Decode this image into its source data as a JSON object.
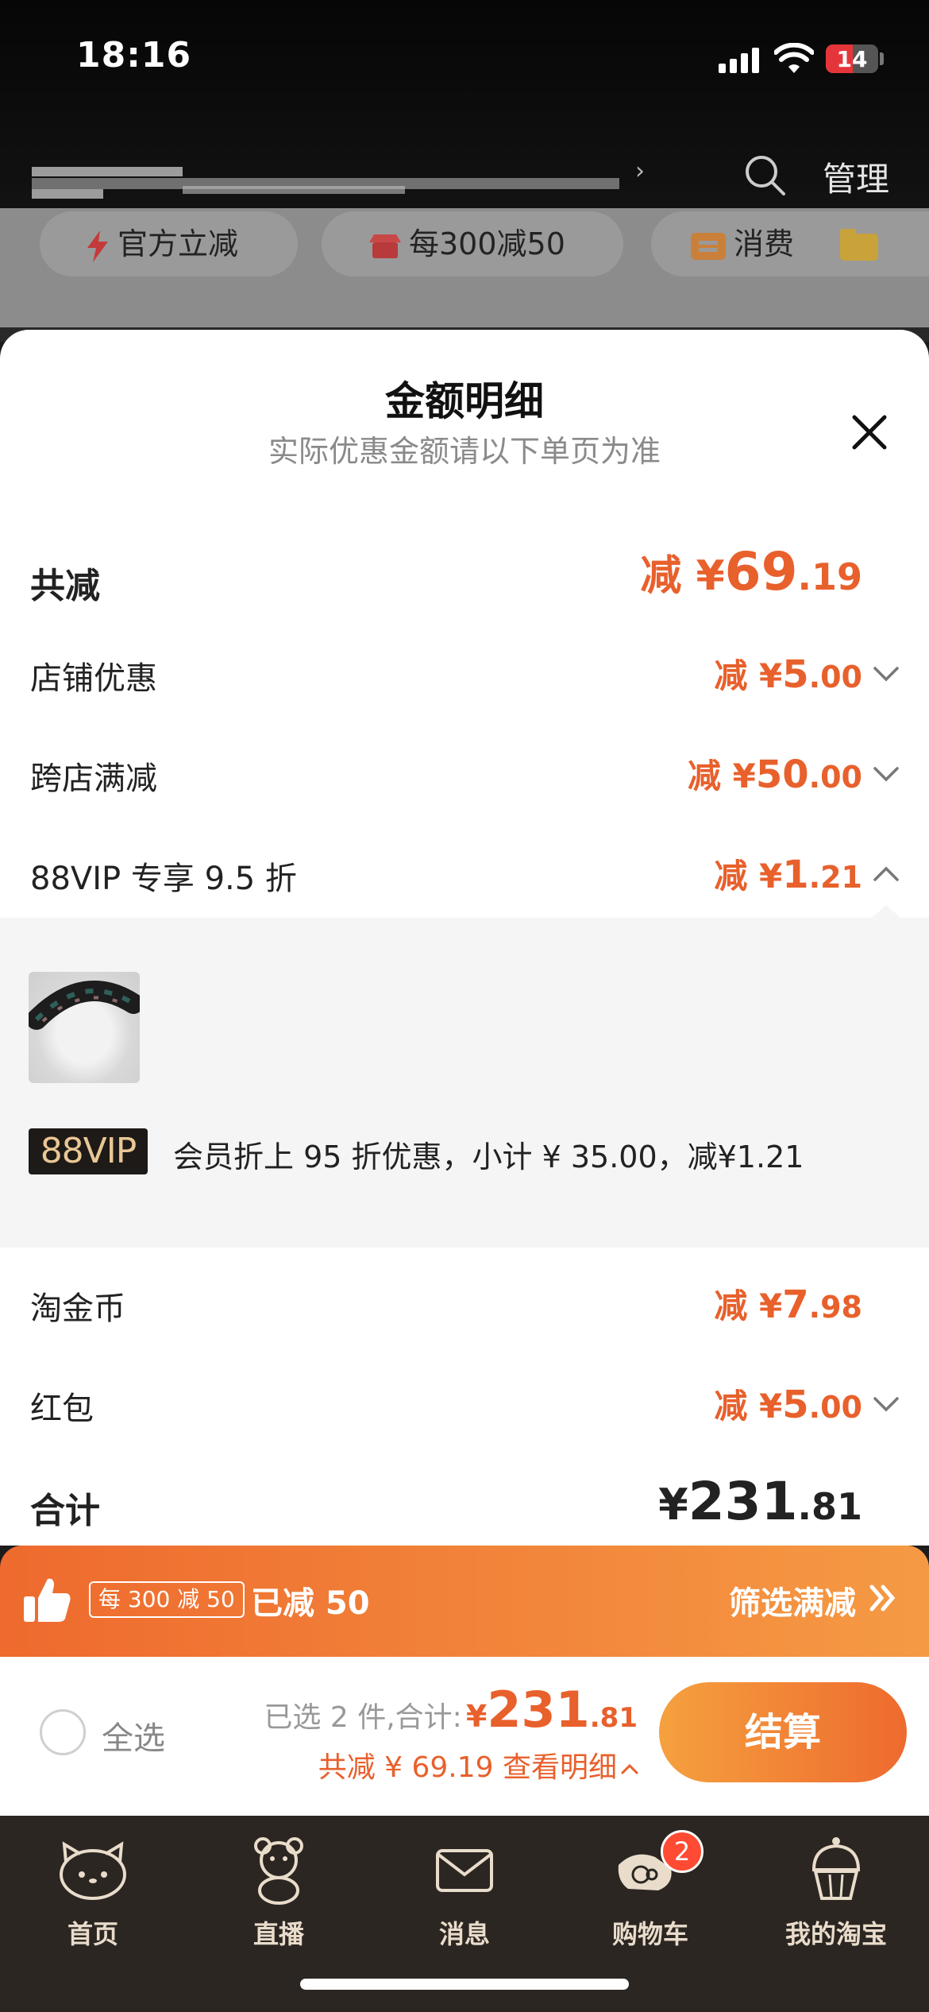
{
  "status_bar": {
    "time": "18:16",
    "battery": "14"
  },
  "store_header": {
    "manage_label": "管理",
    "arrow": "›"
  },
  "promo_pills": [
    "官方立减",
    "每300减50",
    "消费"
  ],
  "sheet": {
    "title": "金额明细",
    "subtitle": "实际优惠金额请以下单页为准"
  },
  "total_discount": {
    "label": "共减",
    "prefix": "减 ¥",
    "int": "69",
    "dec": ".19"
  },
  "rows": [
    {
      "label": "店铺优惠",
      "prefix": "减 ¥",
      "int": "5",
      "dec": ".00",
      "chevron": "down"
    },
    {
      "label": "跨店满减",
      "prefix": "减 ¥",
      "int": "50",
      "dec": ".00",
      "chevron": "down"
    },
    {
      "label": "88VIP 专享 9.5 折",
      "prefix": "减 ¥",
      "int": "1",
      "dec": ".21",
      "chevron": "up"
    }
  ],
  "vip_detail": {
    "badge": "88VIP",
    "text": "会员折上 95 折优惠，小计 ¥ 35.00，减¥1.21"
  },
  "rows_after": [
    {
      "label": "淘金币",
      "prefix": "减 ¥",
      "int": "7",
      "dec": ".98"
    },
    {
      "label": "红包",
      "prefix": "减 ¥",
      "int": "5",
      "dec": ".00",
      "chevron": "down"
    }
  ],
  "grand_total": {
    "label": "合计",
    "prefix": "¥",
    "int": "231",
    "dec": ".81"
  },
  "promo_banner": {
    "tag": "每 300 减 50",
    "done": "已减 50",
    "filter": "筛选满减"
  },
  "checkout": {
    "select_all": "全选",
    "selected_text": "已选 2 件,合计:",
    "amount_prefix": "¥",
    "amount_int": "231",
    "amount_dec": ".81",
    "discount_text": "共减 ¥ 69.19  查看明细",
    "button": "结算"
  },
  "tabs": [
    {
      "label": "首页",
      "icon": "hello-kitty-icon"
    },
    {
      "label": "直播",
      "icon": "teddy-bear-icon"
    },
    {
      "label": "消息",
      "icon": "envelope-icon"
    },
    {
      "label": "购物车",
      "icon": "cart-character-icon",
      "badge": "2"
    },
    {
      "label": "我的淘宝",
      "icon": "cupcake-icon"
    }
  ],
  "colors": {
    "accent": "#e8602c",
    "tab_bg": "#2b2622",
    "vip_gold": "#e9c794"
  }
}
